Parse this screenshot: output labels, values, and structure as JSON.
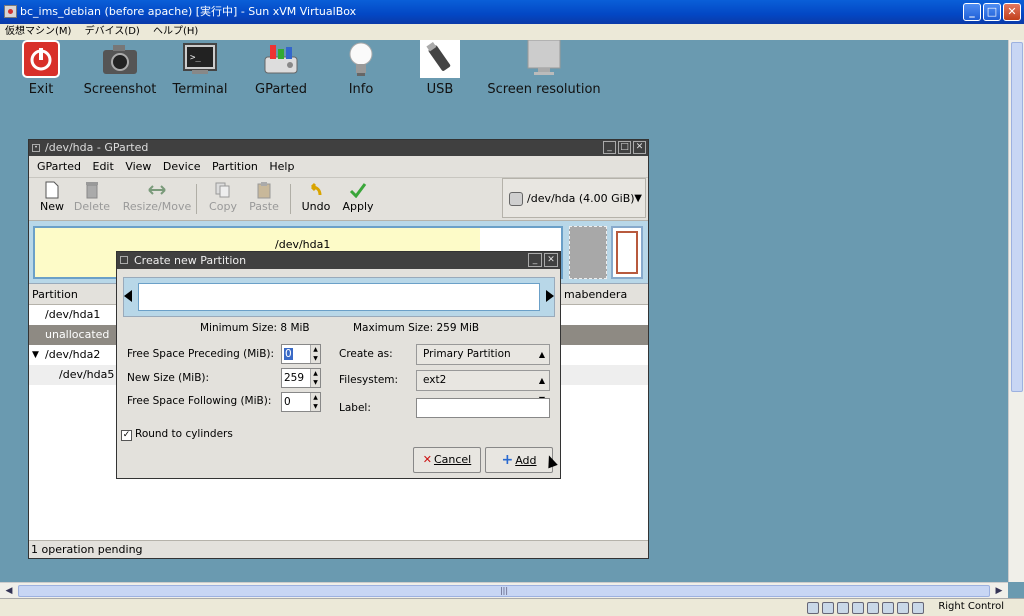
{
  "vbox": {
    "title": "bc_ims_debian (before apache) [実行中] - Sun xVM VirtualBox",
    "menu": [
      "仮想マシン(M)",
      "デバイス(D)",
      "ヘルプ(H)"
    ],
    "host_key": "Right Control"
  },
  "desktop": {
    "icons": [
      {
        "label": "Exit",
        "icon": "power-icon"
      },
      {
        "label": "Screenshot",
        "icon": "camera-icon"
      },
      {
        "label": "Terminal",
        "icon": "terminal-icon"
      },
      {
        "label": "GParted",
        "icon": "gparted-icon"
      },
      {
        "label": "Info",
        "icon": "lightbulb-icon"
      },
      {
        "label": "USB",
        "icon": "usb-icon"
      },
      {
        "label": "Screen resolution",
        "icon": "monitor-icon"
      }
    ]
  },
  "gparted": {
    "title": "/dev/hda - GParted",
    "menu": [
      "GParted",
      "Edit",
      "View",
      "Device",
      "Partition",
      "Help"
    ],
    "toolbar": {
      "new": "New",
      "delete": "Delete",
      "resize": "Resize/Move",
      "copy": "Copy",
      "paste": "Paste",
      "undo": "Undo",
      "apply": "Apply"
    },
    "device": "/dev/hda  (4.00 GiB)",
    "visual_label": "/dev/hda1",
    "columns": {
      "partition": "Partition",
      "flags": "mabendera"
    },
    "rows": [
      "/dev/hda1",
      "unallocated",
      "/dev/hda2",
      "/dev/hda5"
    ],
    "status": "1 operation pending"
  },
  "dialog": {
    "title": "Create new Partition",
    "min_size": "Minimum Size: 8 MiB",
    "max_size": "Maximum Size: 259 MiB",
    "free_preceding_label": "Free Space Preceding (MiB):",
    "free_preceding_value": "0",
    "new_size_label": "New Size (MiB):",
    "new_size_value": "259",
    "free_following_label": "Free Space Following (MiB):",
    "free_following_value": "0",
    "create_as_label": "Create as:",
    "create_as_value": "Primary Partition",
    "filesystem_label": "Filesystem:",
    "filesystem_value": "ext2",
    "label_label": "Label:",
    "round_label": "Round to cylinders",
    "cancel": "Cancel",
    "add": "Add"
  }
}
